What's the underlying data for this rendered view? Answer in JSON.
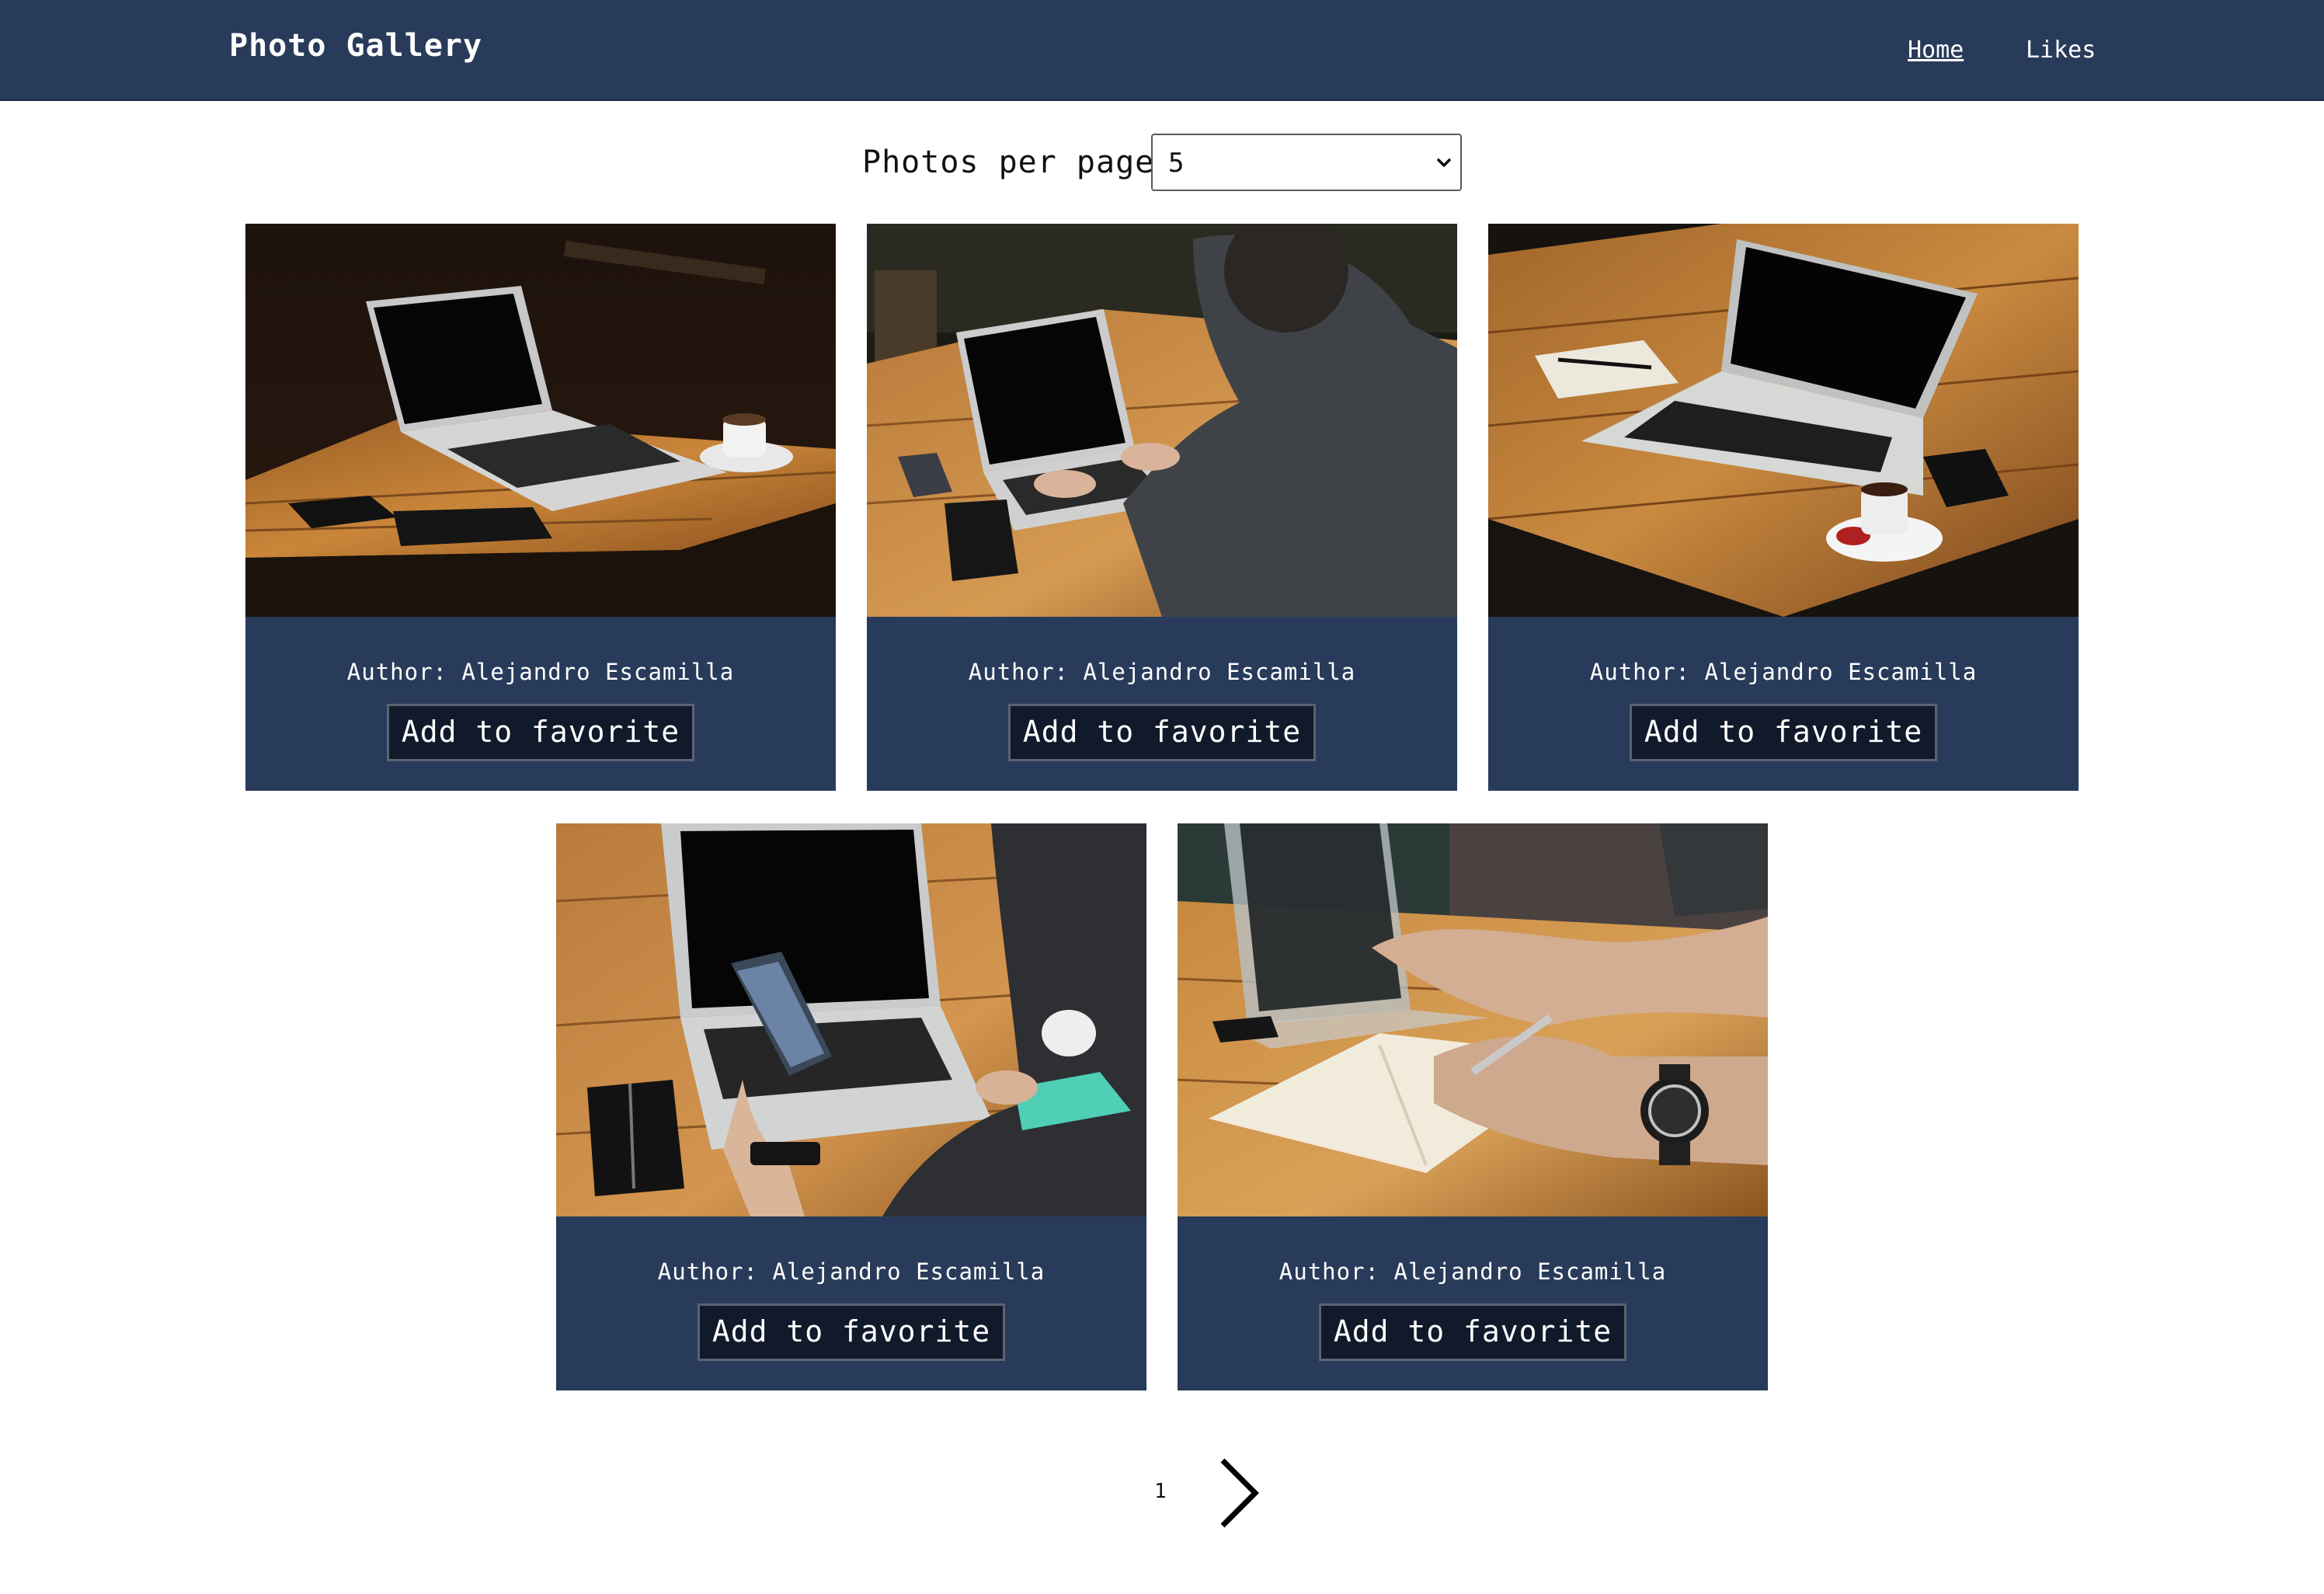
{
  "header": {
    "brand": "Photo Gallery",
    "nav": [
      {
        "label": "Home",
        "active": true
      },
      {
        "label": "Likes",
        "active": false
      }
    ],
    "background": "#293b5a"
  },
  "controls": {
    "per_page_label": "Photos per page:",
    "per_page_value": "5"
  },
  "photos": [
    {
      "author": "Author: Alejandro Escamilla",
      "button": "Add to favorite",
      "scene": "laptop on wooden table with coffee cup and phone"
    },
    {
      "author": "Author: Alejandro Escamilla",
      "button": "Add to favorite",
      "scene": "man typing on laptop at wooden table"
    },
    {
      "author": "Author: Alejandro Escamilla",
      "button": "Add to favorite",
      "scene": "laptop with notebook and coffee cup"
    },
    {
      "author": "Author: Alejandro Escamilla",
      "button": "Add to favorite",
      "scene": "hand holding phone in front of laptop"
    },
    {
      "author": "Author: Alejandro Escamilla",
      "button": "Add to favorite",
      "scene": "hand writing in notebook with wristwatch"
    }
  ],
  "pagination": {
    "current_page": "1"
  },
  "colors": {
    "card_bg": "#293b5a",
    "button_bg": "#111a2b",
    "wood": "#b5772f"
  }
}
